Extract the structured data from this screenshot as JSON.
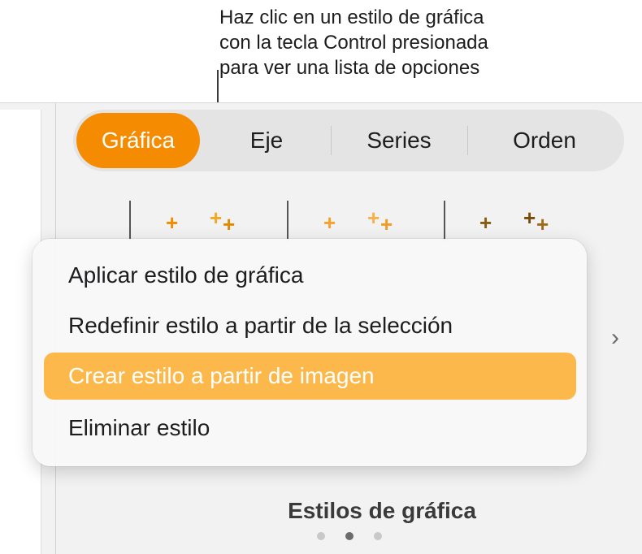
{
  "callout": {
    "line1": "Haz clic en un estilo de gráfica",
    "line2": "con la tecla Control presionada",
    "line3": "para ver una lista de opciones"
  },
  "tabs": [
    {
      "label": "Gráfica",
      "active": true
    },
    {
      "label": "Eje",
      "active": false
    },
    {
      "label": "Series",
      "active": false
    },
    {
      "label": "Orden",
      "active": false
    }
  ],
  "context_menu": {
    "items": [
      {
        "label": "Aplicar estilo de gráfica",
        "highlighted": false
      },
      {
        "label": "Redefinir estilo a partir de la selección",
        "highlighted": false
      },
      {
        "label": "Crear estilo a partir de imagen",
        "highlighted": true
      },
      {
        "label": "Eliminar estilo",
        "highlighted": false
      }
    ]
  },
  "styles_section": {
    "label": "Estilos de gráfica",
    "page_count": 3,
    "current_page": 2
  },
  "icons": {
    "next": "chevron-right-icon"
  },
  "colors": {
    "accent": "#f58b00",
    "menu_highlight": "#fcb84b"
  }
}
